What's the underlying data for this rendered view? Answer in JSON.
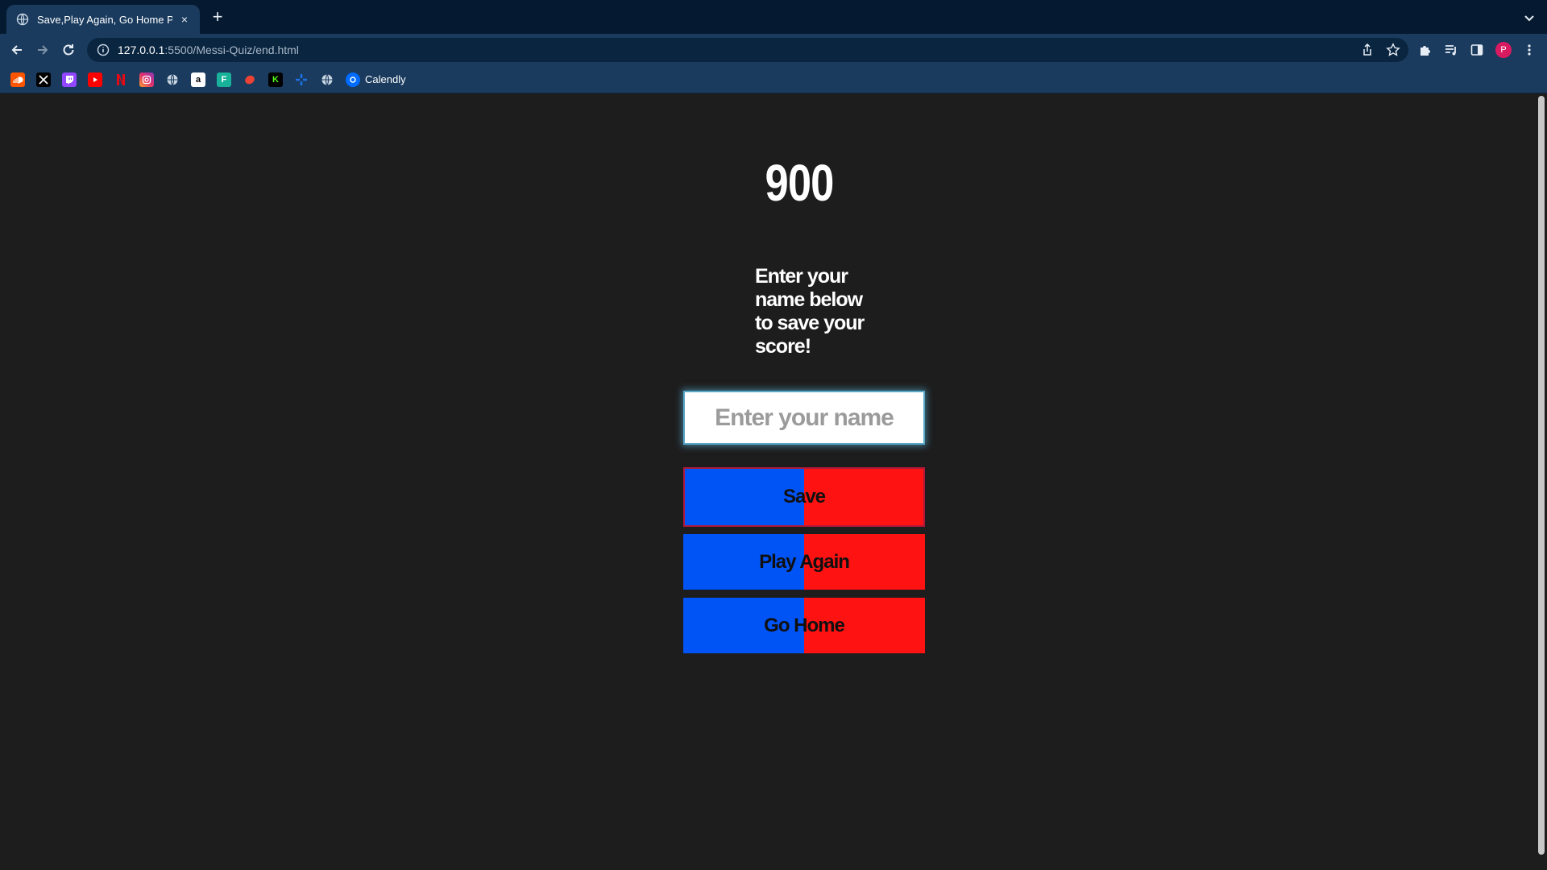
{
  "browser": {
    "tab_title": "Save,Play Again, Go Home Pag",
    "new_tab_symbol": "+",
    "close_symbol": "×",
    "url_host": "127.0.0.1",
    "url_path": ":5500/Messi-Quiz/end.html",
    "avatar_letter": "P",
    "bookmarks": [
      {
        "icon": "soundcloud-icon",
        "color": "#ff5500"
      },
      {
        "icon": "x-icon",
        "color": "#000000"
      },
      {
        "icon": "twitch-icon",
        "color": "#9146ff"
      },
      {
        "icon": "youtube-icon",
        "color": "#ff0000"
      },
      {
        "icon": "netflix-icon",
        "color": "#e50914"
      },
      {
        "icon": "instagram-icon",
        "color": "#e1306c"
      },
      {
        "icon": "globe-icon",
        "color": "#5f6368"
      },
      {
        "icon": "amazon-icon",
        "color": "#ffffff"
      },
      {
        "icon": "f-app-icon",
        "color": "#18b29a"
      },
      {
        "icon": "red-app-icon",
        "color": "#ea4335"
      },
      {
        "icon": "kick-icon",
        "color": "#53fc18"
      },
      {
        "icon": "blue-app-icon",
        "color": "#1a73e8"
      },
      {
        "icon": "globe-icon",
        "color": "#5f6368"
      },
      {
        "icon": "calendly-icon",
        "color": "#006bff"
      }
    ],
    "bookmark_label": "Calendly"
  },
  "page": {
    "score": "900",
    "prompt": "Enter your name below to save your score!",
    "input_placeholder": "Enter your name",
    "buttons": {
      "save": "Save",
      "play_again": "Play Again",
      "go_home": "Go Home"
    },
    "colors": {
      "background": "#1d1d1d",
      "button_blue": "#0053f5",
      "button_red": "#ff1212"
    }
  }
}
